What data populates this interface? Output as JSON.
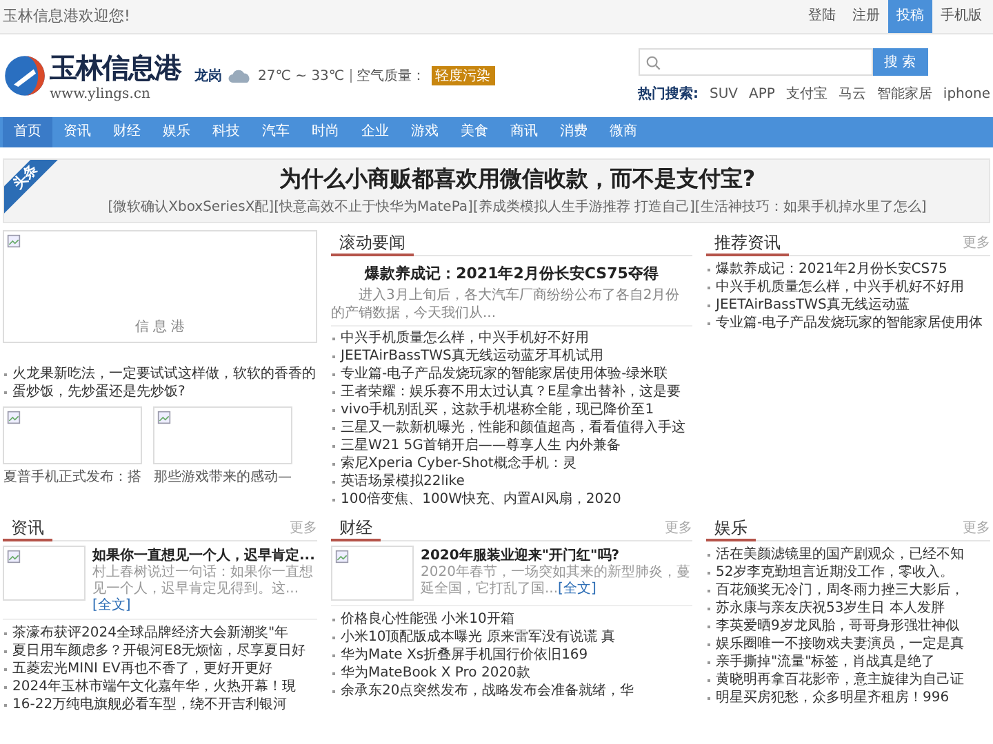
{
  "topbar": {
    "welcome": "玉林信息港欢迎您!",
    "links": [
      {
        "label": "登陆",
        "selected": false
      },
      {
        "label": "注册",
        "selected": false
      },
      {
        "label": "投稿",
        "selected": true
      },
      {
        "label": "手机版",
        "selected": false
      }
    ]
  },
  "header": {
    "logo_text": "玉林信息港",
    "logo_url": "www.ylings.cn",
    "city": "龙岗",
    "temperature": "27℃ ~ 33℃",
    "air_label": "空气质量：",
    "air_value": "轻度污染",
    "search_button": "搜 索",
    "hot_label": "热门搜索:",
    "hot": [
      "SUV",
      "APP",
      "支付宝",
      "马云",
      "智能家居",
      "iphone"
    ]
  },
  "nav": [
    {
      "label": "首页",
      "selected": true
    },
    {
      "label": "资讯",
      "selected": false
    },
    {
      "label": "财经",
      "selected": false
    },
    {
      "label": "娱乐",
      "selected": false
    },
    {
      "label": "科技",
      "selected": false
    },
    {
      "label": "汽车",
      "selected": false
    },
    {
      "label": "时尚",
      "selected": false
    },
    {
      "label": "企业",
      "selected": false
    },
    {
      "label": "游戏",
      "selected": false
    },
    {
      "label": "美食",
      "selected": false
    },
    {
      "label": "商讯",
      "selected": false
    },
    {
      "label": "消费",
      "selected": false
    },
    {
      "label": "微商",
      "selected": false
    }
  ],
  "headline": {
    "badge": "头条",
    "title": "为什么小商贩都喜欢用微信收款，而不是支付宝?",
    "links": [
      "[微软确认XboxSeriesX配]",
      "[快意高效不止于快华为MatePa]",
      "[养成类模拟人生手游推荐 打造自己]",
      "[生活神技巧：如果手机掉水里了怎么]"
    ]
  },
  "left": {
    "main_image_caption": "信 息 港",
    "items": [
      "火龙果新吃法，一定要试试这样做，软软的香香的",
      "蛋炒饭，先炒蛋还是先炒饭?"
    ],
    "thumbs": [
      "夏普手机正式发布：搭",
      "那些游戏带来的感动—"
    ]
  },
  "rolling": {
    "title": "滚动要闻",
    "feature_title": "爆款养成记：2021年2月份长安CS75夺得",
    "feature_summary": "进入3月上旬后，各大汽车厂商纷纷公布了各自2月份的产销数据，今天我们从...",
    "items": [
      "中兴手机质量怎么样，中兴手机好不好用",
      "JEETAirBassTWS真无线运动蓝牙耳机试用",
      "专业篇-电子产品发烧玩家的智能家居使用体验-绿米联",
      "王者荣耀：娱乐赛不用太过认真？E星拿出替补，这是要",
      "vivo手机别乱买，这款手机堪称全能，现已降价至1",
      "三星又一款新机曝光，性能和颜值超高，看看值得入手这",
      "三星W21 5G首销开启——尊享人生 内外兼备",
      "索尼Xperia Cyber-Shot概念手机：灵",
      "英语场景模拟22like",
      "100倍变焦、100W快充、内置AI风扇，2020"
    ]
  },
  "recommend": {
    "title": "推荐资讯",
    "more": "更多",
    "items": [
      "爆款养成记：2021年2月份长安CS75",
      "中兴手机质量怎么样，中兴手机好不好用",
      "JEETAirBassTWS真无线运动蓝",
      "专业篇-电子产品发烧玩家的智能家居使用体"
    ]
  },
  "sections": [
    {
      "title": "资讯",
      "more": "更多",
      "feature_title": "如果你一直想见一个人，迟早肯定...",
      "feature_summary": "村上春树说过一句话：如果你一直想见一个人，迟早肯定见得到。这...",
      "feature_link": "[全文]",
      "items": [
        "茶濠布获评2024全球品牌经济大会新潮奖\"年",
        "夏日用车颜虑多？开银河E8无烦恼，尽享夏日好",
        "五菱宏光MINI EV再也不香了，更好开更好",
        "2024年玉林市端午文化嘉年华，火热开幕！現",
        "16-22万纯电旗舰必看车型，绕不开吉利银河"
      ]
    },
    {
      "title": "财经",
      "more": "更多",
      "feature_title": "2020年服装业迎来\"开门红\"吗?",
      "feature_summary": "2020年春节，一场突如其来的新型肺炎，蔓延全国，它打乱了国...",
      "feature_link": "[全文]",
      "items": [
        "价格良心性能强 小米10开箱",
        "小米10顶配版成本曝光 原来雷军没有说谎 真",
        "华为Mate Xs折叠屏手机国行价依旧169",
        "华为MateBook X Pro 2020款",
        "余承东20点突然发布，战略发布会准备就绪，华"
      ]
    }
  ],
  "entertainment": {
    "title": "娱乐",
    "more": "更多",
    "items": [
      "活在美颜滤镜里的国产剧观众，已经不知",
      "52岁李克勤坦言近期没工作，零收入。",
      "百花颁奖无冷门，周冬雨力挫三大影后，",
      "苏永康与亲友庆祝53岁生日 本人发胖",
      "李英爱晒9岁龙凤胎，哥哥身形强壮神似",
      "娱乐圈唯一不接吻戏夫妻演员，一定是真",
      "亲手撕掉\"流量\"标签，肖战真是绝了",
      "黄晓明再拿百花影帝，意主旋律为自己证",
      "明星买房犯愁，众多明星齐租房！996"
    ]
  }
}
